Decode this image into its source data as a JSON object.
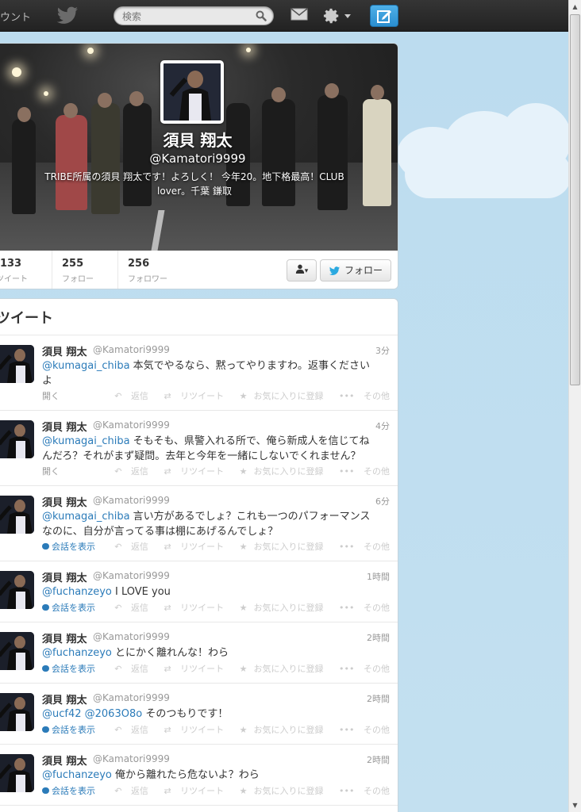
{
  "topbar": {
    "account_label": "ウント",
    "search_placeholder": "検索"
  },
  "profile": {
    "name": "須貝 翔太",
    "handle": "@Kamatori9999",
    "bio_line1": "TRIBE所属の須貝 翔太です！よろしく！ 今年20。地下格最高！CLUB",
    "bio_line2": "lover。千葉 鎌取",
    "stats": [
      {
        "value": ",133",
        "label": "ツイート"
      },
      {
        "value": "255",
        "label": "フォロー"
      },
      {
        "value": "256",
        "label": "フォロワー"
      }
    ],
    "user_menu_label": "▾",
    "follow_label": "フォロー"
  },
  "timeline": {
    "title": "ツイート",
    "actions": {
      "reply": "返信",
      "retweet": "リツイート",
      "favorite": "お気に入りに登録",
      "more": "その他"
    },
    "tweets": [
      {
        "name": "須貝 翔太",
        "handle": "@Kamatori9999",
        "time": "3分",
        "mention": "@kumagai_chiba",
        "text": " 本気でやるなら、黙ってやりますわ。返事ください",
        "text2": "よ",
        "expand": "開く",
        "conv": false
      },
      {
        "name": "須貝 翔太",
        "handle": "@Kamatori9999",
        "time": "4分",
        "mention": "@kumagai_chiba",
        "text": " そもそも、県警入れる所で、俺ら新成人を信じてね",
        "text2": "んだろ？それがまず疑問。去年と今年を一緒にしないでくれません？",
        "expand": "開く",
        "conv": false
      },
      {
        "name": "須貝 翔太",
        "handle": "@Kamatori9999",
        "time": "6分",
        "mention": "@kumagai_chiba",
        "text": " 言い方があるでしょ？これも一つのパフォーマンス",
        "text2": "なのに、自分が言ってる事は棚にあげるんでしょ？",
        "expand": "会話を表示",
        "conv": true
      },
      {
        "name": "須貝 翔太",
        "handle": "@Kamatori9999",
        "time": "1時間",
        "mention": "@fuchanzeyo",
        "text": " I LOVE you",
        "text2": "",
        "expand": "会話を表示",
        "conv": true
      },
      {
        "name": "須貝 翔太",
        "handle": "@Kamatori9999",
        "time": "2時間",
        "mention": "@fuchanzeyo",
        "text": " とにかく離れんな！わら",
        "text2": "",
        "expand": "会話を表示",
        "conv": true
      },
      {
        "name": "須貝 翔太",
        "handle": "@Kamatori9999",
        "time": "2時間",
        "mention": "@ucf42 @2063O8o",
        "text": " そのつもりです！",
        "text2": "",
        "expand": "会話を表示",
        "conv": true
      },
      {
        "name": "須貝 翔太",
        "handle": "@Kamatori9999",
        "time": "2時間",
        "mention": "@fuchanzeyo",
        "text": " 俺から離れたら危ないよ？わら",
        "text2": "",
        "expand": "会話を表示",
        "conv": true
      }
    ]
  }
}
